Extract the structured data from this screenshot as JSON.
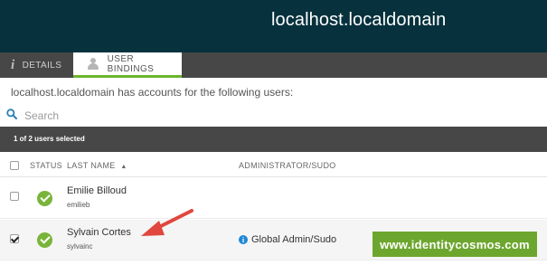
{
  "header": {
    "title": "localhost.localdomain"
  },
  "tabs": [
    {
      "label": "DETAILS",
      "icon": "info-italic-icon"
    },
    {
      "label": "USER BINDINGS",
      "icon": "user-icon",
      "active": true
    }
  ],
  "main": {
    "accounts_text": "localhost.localdomain has accounts for the following users:",
    "search": {
      "placeholder": "Search",
      "value": ""
    },
    "selection_status": "1 of 2 users selected"
  },
  "table": {
    "columns": [
      "STATUS",
      "LAST NAME",
      "ADMINISTRATOR/SUDO"
    ],
    "sort_column": "LAST NAME",
    "sort_direction": "ascending",
    "rows": [
      {
        "name": "Emilie Billoud",
        "login": "emilieb",
        "selected": false,
        "status": "ok",
        "admin": ""
      },
      {
        "name": "Sylvain Cortes",
        "login": "sylvainc",
        "selected": true,
        "status": "ok",
        "admin": "Global Admin/Sudo"
      }
    ]
  },
  "watermark": {
    "text": "www.identitycosmos.com"
  },
  "colors": {
    "header_bg": "#06313d",
    "bar_bg": "#474747",
    "accent_green": "#6bb52d",
    "status_ok": "#79b43a",
    "info_blue": "#1e88d6",
    "arrow_red": "#e0473e"
  }
}
